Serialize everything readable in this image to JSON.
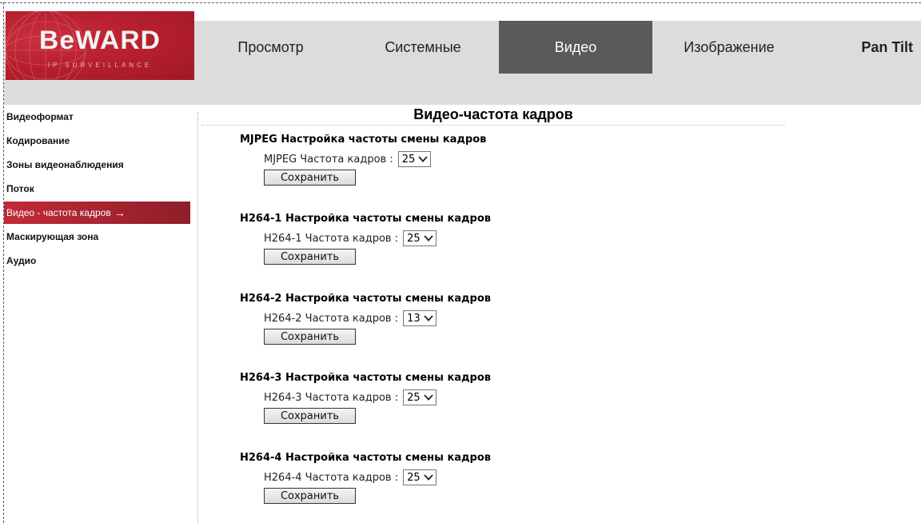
{
  "brand": {
    "logo_text": "BeWARD",
    "logo_subtext": "IP SURVEILLANCE"
  },
  "top_nav": {
    "tabs": [
      {
        "label": "Просмотр",
        "active": false
      },
      {
        "label": "Системные",
        "active": false
      },
      {
        "label": "Видео",
        "active": true
      },
      {
        "label": "Изображение",
        "active": false
      },
      {
        "label": "Pan Tilt",
        "active": false
      }
    ]
  },
  "sidebar": {
    "items": [
      {
        "label": "Видеоформат"
      },
      {
        "label": "Кодирование"
      },
      {
        "label": "Зоны видеонаблюдения"
      },
      {
        "label": "Поток"
      },
      {
        "label": "Видео - частота кадров",
        "active": true,
        "arrow": "→"
      },
      {
        "label": "Маскирующая зона"
      },
      {
        "label": "Аудио"
      }
    ]
  },
  "page": {
    "title": "Видео-частота кадров"
  },
  "sections": [
    {
      "title": "MJPEG Настройка частоты смены кадров",
      "label": "MJPEG Частота кадров :",
      "value": "25",
      "save": "Сохранить"
    },
    {
      "title": "H264-1 Настройка частоты смены кадров",
      "label": "H264-1 Частота кадров :",
      "value": "25",
      "save": "Сохранить"
    },
    {
      "title": "H264-2 Настройка частоты смены кадров",
      "label": "H264-2 Частота кадров :",
      "value": "13",
      "save": "Сохранить"
    },
    {
      "title": "H264-3 Настройка частоты смены кадров",
      "label": "H264-3 Частота кадров :",
      "value": "25",
      "save": "Сохранить"
    },
    {
      "title": "H264-4 Настройка частоты смены кадров",
      "label": "H264-4 Частота кадров :",
      "value": "25",
      "save": "Сохранить"
    }
  ],
  "colors": {
    "brand_red": "#b8202e",
    "active_tab": "#5a5a5a",
    "header_gray": "#dcdcdc"
  }
}
